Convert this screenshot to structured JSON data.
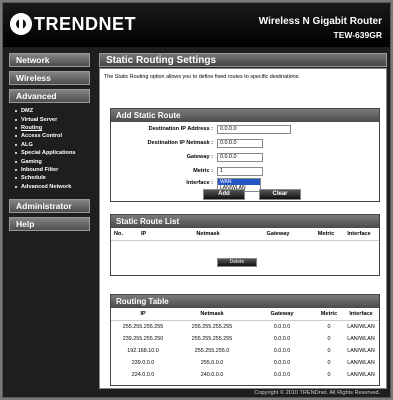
{
  "header": {
    "brand": "TRENDNET",
    "product": "Wireless N Gigabit Router",
    "model": "TEW-639GR"
  },
  "sidebar": {
    "network": "Network",
    "wireless": "Wireless",
    "advanced": "Advanced",
    "items": [
      "DMZ",
      "Virtual Server",
      "Routing",
      "Access Control",
      "ALG",
      "Special Applications",
      "Gaming",
      "Inbound Filter",
      "Schedule",
      "Advanced Network"
    ],
    "active_item": "Routing",
    "administrator": "Administrator",
    "help": "Help"
  },
  "page": {
    "title": "Static Routing Settings",
    "description": "The Static Routing option allows you to define fixed routes to specific destinations."
  },
  "add_route": {
    "title": "Add Static Route",
    "dest_ip_label": "Destination IP Address :",
    "dest_ip_value": "0.0.0.0",
    "netmask_label": "Destination IP Netmask :",
    "netmask_value": "0.0.0.0",
    "gateway_label": "Gateway :",
    "gateway_value": "0.0.0.0",
    "metric_label": "Metric :",
    "metric_value": "1",
    "interface_label": "Interface :",
    "interface_options": [
      "WAN",
      "LAN/WLAN"
    ],
    "interface_selected": "WAN",
    "add_button": "Add",
    "clear_button": "Clear"
  },
  "route_list": {
    "title": "Static Route List",
    "columns": [
      "No.",
      "IP",
      "Netmask",
      "Gateway",
      "Metric",
      "Interface"
    ],
    "delete_button": "Delete"
  },
  "routing_table": {
    "title": "Routing Table",
    "columns": [
      "IP",
      "Netmask",
      "Gateway",
      "Metric",
      "Interface"
    ],
    "rows": [
      [
        "255.255.255.255",
        "255.255.255.255",
        "0.0.0.0",
        "0",
        "LAN/WLAN"
      ],
      [
        "239.255.255.250",
        "255.255.255.255",
        "0.0.0.0",
        "0",
        "LAN/WLAN"
      ],
      [
        "192.168.10.0",
        "255.255.255.0",
        "0.0.0.0",
        "0",
        "LAN/WLAN"
      ],
      [
        "239.0.0.0",
        "255.0.0.0",
        "0.0.0.0",
        "0",
        "LAN/WLAN"
      ],
      [
        "224.0.0.0",
        "240.0.0.0",
        "0.0.0.0",
        "0",
        "LAN/WLAN"
      ]
    ]
  },
  "footer": {
    "copyright": "Copyright © 2010 TRENDnet. All Rights Reserved."
  }
}
